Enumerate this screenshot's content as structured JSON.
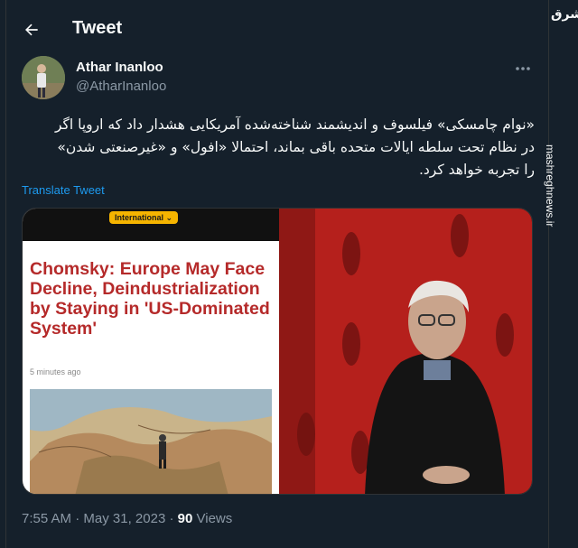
{
  "header": {
    "title": "Tweet"
  },
  "author": {
    "display_name": "Athar Inanloo",
    "handle": "@AtharInanloo"
  },
  "tweet": {
    "text_lines": [
      "«نوام چامسکی» فیلسوف و اندیشمند شناخته‌شده آمریکایی هشدار داد که اروپا اگر",
      "در نظام تحت سلطه ایالات متحده باقی بماند، احتمالا «افول» و «غیرصنعتی شدن»",
      "را تجربه خواهد کرد."
    ],
    "translate_label": "Translate Tweet"
  },
  "media": {
    "badge": "International",
    "headline": "Chomsky: Europe May Face Decline, Deindustrialization by Staying in 'US-Dominated System'",
    "time_ago": "5 minutes ago"
  },
  "meta": {
    "time": "7:55 AM",
    "separator": "·",
    "date": "May 31, 2023",
    "views_count": "90",
    "views_label": "Views"
  },
  "watermark": {
    "logo": "مشرق",
    "site": "mashreghnews.ir"
  },
  "colors": {
    "background": "#15202b",
    "link": "#1d9bf0",
    "muted": "#8b98a5",
    "headline": "#b52a2a"
  }
}
